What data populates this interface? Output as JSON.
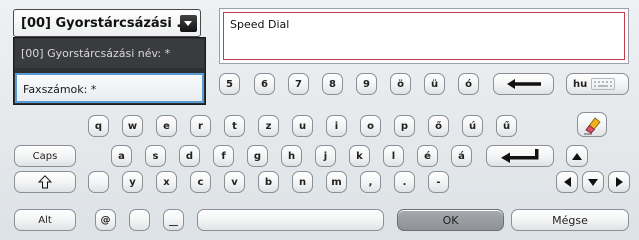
{
  "dropdown": {
    "selected": "[00] Gyorstárcsázási ...",
    "options": [
      "[00] Gyorstárcsázási név: *",
      "Faxszámok: *"
    ]
  },
  "text_field": {
    "value": "Speed Dial"
  },
  "keyboard": {
    "row1": [
      "5",
      "6",
      "7",
      "8",
      "9",
      "ö",
      "ü",
      "ó"
    ],
    "hu_label": "hu",
    "row2": [
      "q",
      "w",
      "e",
      "r",
      "t",
      "z",
      "u",
      "i",
      "o",
      "p",
      "ő",
      "ú",
      "ű"
    ],
    "row3": [
      "a",
      "s",
      "d",
      "f",
      "g",
      "h",
      "j",
      "k",
      "l",
      "é",
      "á"
    ],
    "caps": "Caps",
    "row4": [
      "y",
      "x",
      "c",
      "v",
      "b",
      "n",
      "m",
      ",",
      ".",
      "-"
    ],
    "alt": "Alt",
    "at": "@",
    "ok": "OK",
    "cancel": "Mégse"
  },
  "icons": {
    "dropdown_arrow": "chevron-down-icon",
    "backspace": "backspace-arrow-icon",
    "enter": "enter-arrow-icon",
    "shift": "shift-arrow-icon",
    "clear": "eraser-icon",
    "keyboard_layout": "keyboard-icon"
  },
  "colors": {
    "selection_border": "#5b9bd5",
    "text_field_border": "#c43a4a",
    "dropdown_bg": "#2f3033"
  }
}
